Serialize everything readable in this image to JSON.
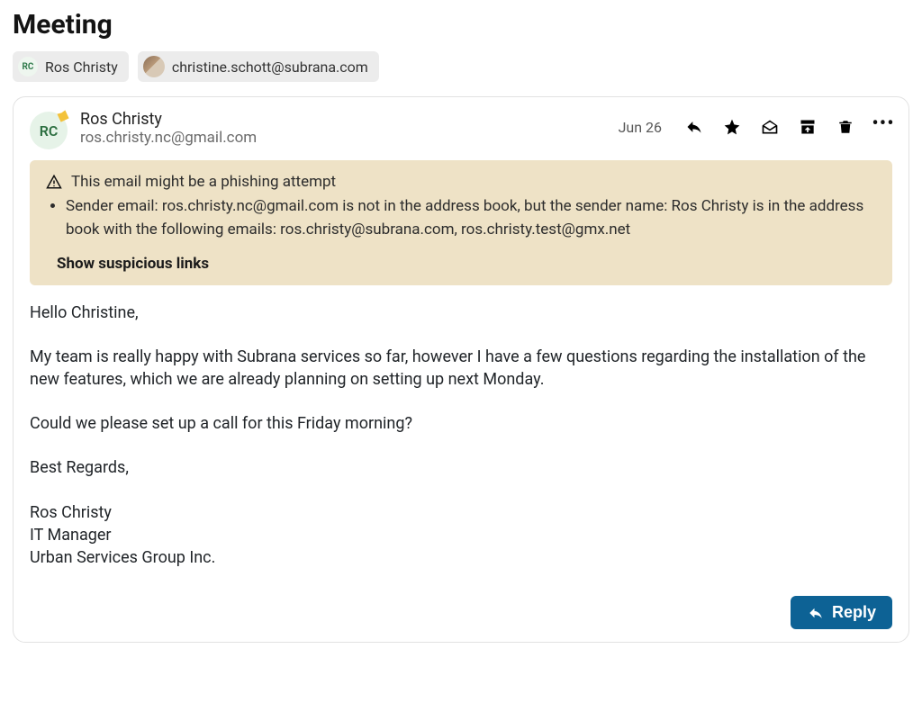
{
  "subject": "Meeting",
  "participants": [
    {
      "initials": "RC",
      "label": "Ros Christy",
      "kind": "initials"
    },
    {
      "initials": "",
      "label": "christine.schott@subrana.com",
      "kind": "photo"
    }
  ],
  "message": {
    "avatar_initials": "RC",
    "sender_name": "Ros Christy",
    "sender_email": "ros.christy.nc@gmail.com",
    "date": "Jun 26"
  },
  "warning": {
    "title": "This email might be a phishing attempt",
    "bullet": "Sender email: ros.christy.nc@gmail.com is not in the address book, but the sender name: Ros Christy is in the address book with the following emails: ros.christy@subrana.com, ros.christy.test@gmx.net",
    "show_label": "Show suspicious links"
  },
  "body": {
    "greeting": "Hello Christine,",
    "p1": "My team is really happy with Subrana services so far, however I have a few questions regarding the installation of the new features, which we are already planning on setting up next Monday.",
    "p2": "Could we please set up a call for this Friday morning?",
    "closing": "Best Regards,",
    "sig1": "Ros Christy",
    "sig2": "IT Manager",
    "sig3": "Urban Services Group Inc."
  },
  "reply_label": "Reply"
}
